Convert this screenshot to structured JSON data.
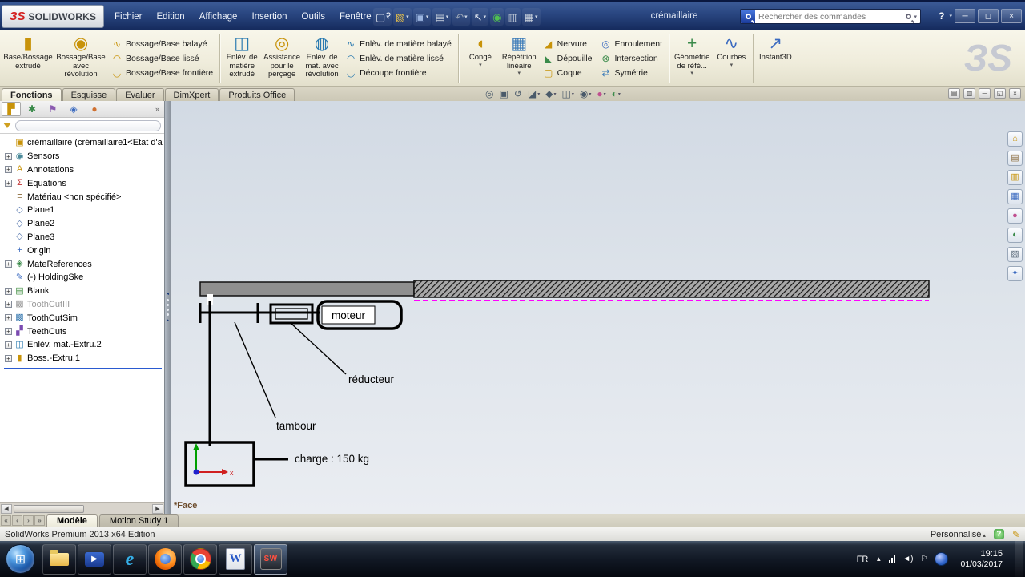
{
  "titlebar": {
    "logo_mark": "ЗS",
    "logo_text": "SOLIDWORKS",
    "menus": [
      "Fichier",
      "Edition",
      "Affichage",
      "Insertion",
      "Outils",
      "Fenêtre",
      "?"
    ],
    "document_title": "crémaillaire",
    "search_placeholder": "Rechercher des commandes",
    "quickbar": [
      {
        "name": "new-document-icon",
        "glyph": "▢",
        "color": "#e8ecf4",
        "caret": "▾"
      },
      {
        "name": "open-icon",
        "glyph": "▧",
        "color": "#e8c04a",
        "caret": "▾"
      },
      {
        "name": "save-icon",
        "glyph": "▣",
        "color": "#9ab4e0",
        "caret": "▾"
      },
      {
        "name": "print-icon",
        "glyph": "▤",
        "color": "#c8d0dc",
        "caret": "▾"
      },
      {
        "name": "undo-icon",
        "glyph": "↶",
        "color": "#97a2b4",
        "caret": "▾"
      },
      {
        "name": "select-icon",
        "glyph": "↖",
        "color": "#e8ecf4",
        "caret": "▾"
      },
      {
        "name": "rebuild-icon",
        "glyph": "◉",
        "color": "#50c050",
        "caret": ""
      },
      {
        "name": "file-properties-icon",
        "glyph": "▥",
        "color": "#c8d0dc",
        "caret": ""
      },
      {
        "name": "options-icon",
        "glyph": "▦",
        "color": "#c8d0dc",
        "caret": "▾"
      }
    ],
    "window": {
      "help": "?",
      "caret": "▾",
      "minimize": "─",
      "maximize": "◻",
      "close": "×"
    }
  },
  "ribbon": {
    "big": [
      {
        "label": "Base/Bossage\nextrudé",
        "glyph": "▮",
        "color": "#c8930a",
        "caret": ""
      },
      {
        "label": "Bossage/Base\navec\nrévolution",
        "glyph": "◉",
        "color": "#c8930a",
        "caret": ""
      },
      {
        "label": "Enlèv. de\nmatière\nextrudé",
        "glyph": "◫",
        "color": "#2a7ab0",
        "caret": ""
      },
      {
        "label": "Assistance\npour le\nperçage",
        "glyph": "◎",
        "color": "#c8930a",
        "caret": ""
      },
      {
        "label": "Enlèv. de\nmat. avec\nrévolution",
        "glyph": "◍",
        "color": "#2a7ab0",
        "caret": ""
      },
      {
        "label": "Congé",
        "glyph": "◖",
        "color": "#c8930a",
        "caret": "▾"
      },
      {
        "label": "Répétition\nlinéaire",
        "glyph": "▦",
        "color": "#3a7ab8",
        "caret": "▾"
      },
      {
        "label": "Géométrie\nde réfé...",
        "glyph": "+",
        "color": "#3a8a4a",
        "caret": "▾"
      },
      {
        "label": "Courbes",
        "glyph": "∿",
        "color": "#3a6ac0",
        "caret": "▾"
      },
      {
        "label": "Instant3D",
        "glyph": "↗",
        "color": "#3a6ac0",
        "caret": ""
      }
    ],
    "small": [
      {
        "label": "Bossage/Base balayé",
        "glyph": "∿",
        "color": "#c8930a"
      },
      {
        "label": "Bossage/Base lissé",
        "glyph": "◠",
        "color": "#c8930a"
      },
      {
        "label": "Bossage/Base frontière",
        "glyph": "◡",
        "color": "#c8930a"
      },
      {
        "label": "Enlèv. de matière balayé",
        "glyph": "∿",
        "color": "#2a7ab0"
      },
      {
        "label": "Enlèv. de matière lissé",
        "glyph": "◠",
        "color": "#2a7ab0"
      },
      {
        "label": "Découpe frontière",
        "glyph": "◡",
        "color": "#2a7ab0"
      },
      {
        "label": "Nervure",
        "glyph": "◢",
        "color": "#c8930a"
      },
      {
        "label": "Dépouille",
        "glyph": "◣",
        "color": "#3a8a4a"
      },
      {
        "label": "Coque",
        "glyph": "▢",
        "color": "#c8930a"
      },
      {
        "label": "Enroulement",
        "glyph": "◎",
        "color": "#3a6ac0"
      },
      {
        "label": "Intersection",
        "glyph": "⊗",
        "color": "#3a8a4a"
      },
      {
        "label": "Symétrie",
        "glyph": "⇄",
        "color": "#3a7ab8"
      }
    ]
  },
  "tabs": [
    "Fonctions",
    "Esquisse",
    "Evaluer",
    "DimXpert",
    "Produits Office"
  ],
  "headsup": [
    {
      "name": "zoom-fit-icon",
      "glyph": "◎",
      "color": "#4a5a6a",
      "caret": ""
    },
    {
      "name": "zoom-area-icon",
      "glyph": "▣",
      "color": "#4a5a6a",
      "caret": ""
    },
    {
      "name": "previous-view-icon",
      "glyph": "↺",
      "color": "#4a5a6a",
      "caret": ""
    },
    {
      "name": "section-view-icon",
      "glyph": "◪",
      "color": "#4a5a6a",
      "caret": "▾"
    },
    {
      "name": "view-orientation-icon",
      "glyph": "◆",
      "color": "#4a5a6a",
      "caret": "▾"
    },
    {
      "name": "display-style-icon",
      "glyph": "◫",
      "color": "#4a5a6a",
      "caret": "▾"
    },
    {
      "name": "hide-show-items-icon",
      "glyph": "◉",
      "color": "#4a5a6a",
      "caret": "▾"
    },
    {
      "name": "edit-appearance-icon",
      "glyph": "●",
      "color": "#c05090",
      "caret": "▾"
    },
    {
      "name": "apply-scene-icon",
      "glyph": "◐",
      "color": "#3a8a4a",
      "caret": "▾"
    }
  ],
  "docwin": [
    {
      "name": "document-pane-toggle-icon",
      "glyph": "▤"
    },
    {
      "name": "document-pane-split-icon",
      "glyph": "▥"
    },
    {
      "name": "document-minimize-button",
      "glyph": "─"
    },
    {
      "name": "document-restore-button",
      "glyph": "◱"
    },
    {
      "name": "document-close-button",
      "glyph": "×"
    }
  ],
  "panel_tabs": [
    {
      "name": "featuremanager-tab-icon",
      "glyph": "▛",
      "color": "#c8930a"
    },
    {
      "name": "propertymanager-tab-icon",
      "glyph": "✱",
      "color": "#3a8a4a"
    },
    {
      "name": "configurationmanager-tab-icon",
      "glyph": "⚑",
      "color": "#8a5ab0"
    },
    {
      "name": "dimxpertmanager-tab-icon",
      "glyph": "◈",
      "color": "#3a6ac0"
    },
    {
      "name": "displaymanager-tab-icon",
      "glyph": "●",
      "color": "#d07030"
    }
  ],
  "panel_tabs_overflow": "»",
  "tree": {
    "root": {
      "label": "crémaillaire  (crémaillaire1<Etat d'a",
      "glyph": "▣",
      "color": "#c8930a"
    },
    "items": [
      {
        "label": "Sensors",
        "glyph": "◉",
        "color": "#4a8a9a",
        "expand": "+",
        "text": "#000000"
      },
      {
        "label": "Annotations",
        "glyph": "A",
        "color": "#c8930a",
        "expand": "+",
        "text": "#000000"
      },
      {
        "label": "Equations",
        "glyph": "Σ",
        "color": "#c03030",
        "expand": "+",
        "text": "#000000"
      },
      {
        "label": "Matériau <non spécifié>",
        "glyph": "≡",
        "color": "#8a6a3a",
        "expand": "",
        "text": "#000000"
      },
      {
        "label": "Plane1",
        "glyph": "◇",
        "color": "#5a7ab0",
        "expand": "",
        "text": "#000000"
      },
      {
        "label": "Plane2",
        "glyph": "◇",
        "color": "#5a7ab0",
        "expand": "",
        "text": "#000000"
      },
      {
        "label": "Plane3",
        "glyph": "◇",
        "color": "#5a7ab0",
        "expand": "",
        "text": "#000000"
      },
      {
        "label": "Origin",
        "glyph": "+",
        "color": "#3a6ac0",
        "expand": "",
        "text": "#000000"
      },
      {
        "label": "MateReferences",
        "glyph": "◈",
        "color": "#3a8a4a",
        "expand": "+",
        "text": "#000000"
      },
      {
        "label": "(-) HoldingSke",
        "glyph": "✎",
        "color": "#3a6ac0",
        "expand": "",
        "text": "#000000"
      },
      {
        "label": "Blank",
        "glyph": "▤",
        "color": "#3a8a3a",
        "expand": "+",
        "text": "#000000"
      },
      {
        "label": "ToothCutIII",
        "glyph": "▩",
        "color": "#9a9a9a",
        "expand": "+",
        "text": "#9a9a9a"
      },
      {
        "label": "ToothCutSim",
        "glyph": "▩",
        "color": "#3a7ab0",
        "expand": "+",
        "text": "#000000"
      },
      {
        "label": "TeethCuts",
        "glyph": "▞",
        "color": "#7a4ab0",
        "expand": "+",
        "text": "#000000"
      },
      {
        "label": "Enlèv. mat.-Extru.2",
        "glyph": "◫",
        "color": "#2a7ab0",
        "expand": "+",
        "text": "#000000"
      },
      {
        "label": "Boss.-Extru.1",
        "glyph": "▮",
        "color": "#c8930a",
        "expand": "+",
        "text": "#000000"
      }
    ]
  },
  "task_pane": [
    {
      "name": "solidworks-resources-icon",
      "glyph": "⌂",
      "color": "#c8930a"
    },
    {
      "name": "design-library-icon",
      "glyph": "▤",
      "color": "#8a6a3a"
    },
    {
      "name": "file-explorer-icon",
      "glyph": "▥",
      "color": "#c8930a"
    },
    {
      "name": "view-palette-icon",
      "glyph": "▦",
      "color": "#3a6ac0"
    },
    {
      "name": "appearances-icon",
      "glyph": "●",
      "color": "#c05090"
    },
    {
      "name": "scenes-icon",
      "glyph": "◐",
      "color": "#3a8a4a"
    },
    {
      "name": "custom-properties-icon",
      "glyph": "▧",
      "color": "#5a6a7a"
    },
    {
      "name": "forum-icon",
      "glyph": "✦",
      "color": "#3a6ac0"
    }
  ],
  "canvas": {
    "labels": {
      "moteur": "moteur",
      "reducteur": "réducteur",
      "tambour": "tambour",
      "charge": "charge : 150 kg",
      "axis_x": "x"
    },
    "view_label": "*Face",
    "colors": {
      "pitch": "#ff00ff"
    }
  },
  "bottom": {
    "nav": [
      "«",
      "‹",
      "›",
      "»"
    ],
    "tabs": [
      "Modèle",
      "Motion Study 1"
    ]
  },
  "statusbar": {
    "left": "SolidWorks Premium 2013 x64 Edition",
    "custom": "Personnalisé",
    "caret": "▴",
    "help": "?",
    "edit": "✎"
  },
  "taskbar": {
    "start": "⊞",
    "apps": {
      "media_glyph": "▶",
      "ie_glyph": "e",
      "word_glyph": "W",
      "sw_glyph": "SW"
    },
    "tray": {
      "language": "FR",
      "chevron": "▲",
      "volume": "◄)",
      "flag": "⚐",
      "time": "19:15",
      "date": "01/03/2017"
    }
  },
  "watermark": "ЗS"
}
